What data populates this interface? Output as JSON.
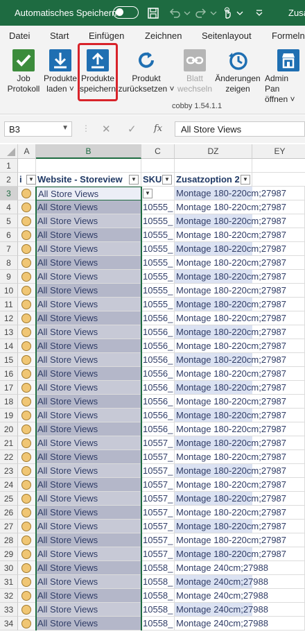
{
  "titlebar": {
    "autosave_label": "Automatisches Speichern",
    "title": "Zusa"
  },
  "tabs": [
    "Datei",
    "Start",
    "Einfügen",
    "Zeichnen",
    "Seitenlayout",
    "Formeln"
  ],
  "ribbon": {
    "buttons": [
      {
        "label1": "Job",
        "label2": "Protokoll",
        "icon": "check-icon",
        "color": "#3c8c3c"
      },
      {
        "label1": "Produkte",
        "label2": "laden ˅",
        "icon": "download-icon",
        "color": "#1f6fb2"
      },
      {
        "label1": "Produkte",
        "label2": "speichern",
        "icon": "upload-icon",
        "color": "#1f6fb2"
      },
      {
        "label1": "Produkt",
        "label2": "zurücksetzen ˅",
        "icon": "reset-icon",
        "color": "#1f6fb2"
      },
      {
        "label1": "Blatt",
        "label2": "wechseln",
        "icon": "chain-icon",
        "color": "#b5b5b5"
      },
      {
        "label1": "Änderungen",
        "label2": "zeigen",
        "icon": "history-icon",
        "color": "#1f6fb2"
      },
      {
        "label1": "Admin Pan",
        "label2": "öffnen ˅",
        "icon": "store-icon",
        "color": "#1f6fb2"
      }
    ],
    "group_label": "cobby 1.54.1.1"
  },
  "formula_bar": {
    "name_box": "B3",
    "fx": "fx",
    "value": "All Store Views"
  },
  "columns": [
    "A",
    "B",
    "C",
    "DZ",
    "EY"
  ],
  "header_row": {
    "a": "i",
    "b": "Website - Storeview",
    "c": "SKU",
    "dz": "Zusatzoption 2"
  },
  "row_numbers": [
    "1",
    "2",
    "3",
    "4",
    "5",
    "6",
    "7",
    "8",
    "9",
    "10",
    "11",
    "12",
    "13",
    "14",
    "15",
    "16",
    "17",
    "18",
    "19",
    "20",
    "21",
    "22",
    "23",
    "24",
    "25",
    "26",
    "27",
    "28",
    "29",
    "30",
    "31",
    "32",
    "33",
    "34"
  ],
  "rows": [
    {
      "b": "All Store Views",
      "c": "",
      "dz": "Montage 180-220cm;27987"
    },
    {
      "b": "All Store Views",
      "c": "10555_",
      "dz": "Montage 180-220cm;27987"
    },
    {
      "b": "All Store Views",
      "c": "10555_",
      "dz": "Montage 180-220cm;27987"
    },
    {
      "b": "All Store Views",
      "c": "10555_",
      "dz": "Montage 180-220cm;27987"
    },
    {
      "b": "All Store Views",
      "c": "10555_",
      "dz": "Montage 180-220cm;27987"
    },
    {
      "b": "All Store Views",
      "c": "10555_",
      "dz": "Montage 180-220cm;27987"
    },
    {
      "b": "All Store Views",
      "c": "10555_",
      "dz": "Montage 180-220cm;27987"
    },
    {
      "b": "All Store Views",
      "c": "10555_",
      "dz": "Montage 180-220cm;27987"
    },
    {
      "b": "All Store Views",
      "c": "10555_",
      "dz": "Montage 180-220cm;27987"
    },
    {
      "b": "All Store Views",
      "c": "10556_",
      "dz": "Montage 180-220cm;27987"
    },
    {
      "b": "All Store Views",
      "c": "10556_",
      "dz": "Montage 180-220cm;27987"
    },
    {
      "b": "All Store Views",
      "c": "10556_",
      "dz": "Montage 180-220cm;27987"
    },
    {
      "b": "All Store Views",
      "c": "10556_",
      "dz": "Montage 180-220cm;27987"
    },
    {
      "b": "All Store Views",
      "c": "10556_",
      "dz": "Montage 180-220cm;27987"
    },
    {
      "b": "All Store Views",
      "c": "10556_",
      "dz": "Montage 180-220cm;27987"
    },
    {
      "b": "All Store Views",
      "c": "10556_",
      "dz": "Montage 180-220cm;27987"
    },
    {
      "b": "All Store Views",
      "c": "10556_",
      "dz": "Montage 180-220cm;27987"
    },
    {
      "b": "All Store Views",
      "c": "10556_",
      "dz": "Montage 180-220cm;27987"
    },
    {
      "b": "All Store Views",
      "c": "10557_",
      "dz": "Montage 180-220cm;27987"
    },
    {
      "b": "All Store Views",
      "c": "10557_",
      "dz": "Montage 180-220cm;27987"
    },
    {
      "b": "All Store Views",
      "c": "10557_",
      "dz": "Montage 180-220cm;27987"
    },
    {
      "b": "All Store Views",
      "c": "10557_",
      "dz": "Montage 180-220cm;27987"
    },
    {
      "b": "All Store Views",
      "c": "10557_",
      "dz": "Montage 180-220cm;27987"
    },
    {
      "b": "All Store Views",
      "c": "10557_",
      "dz": "Montage 180-220cm;27987"
    },
    {
      "b": "All Store Views",
      "c": "10557_",
      "dz": "Montage 180-220cm;27987"
    },
    {
      "b": "All Store Views",
      "c": "10557_",
      "dz": "Montage 180-220cm;27987"
    },
    {
      "b": "All Store Views",
      "c": "10557_",
      "dz": "Montage 180-220cm;27987"
    },
    {
      "b": "All Store Views",
      "c": "10558_",
      "dz": "Montage 240cm;27988"
    },
    {
      "b": "All Store Views",
      "c": "10558_",
      "dz": "Montage 240cm;27988"
    },
    {
      "b": "All Store Views",
      "c": "10558_",
      "dz": "Montage 240cm;27988"
    },
    {
      "b": "All Store Views",
      "c": "10558_",
      "dz": "Montage 240cm;27988"
    },
    {
      "b": "All Store Views",
      "c": "10558_",
      "dz": "Montage 240cm;27988"
    }
  ],
  "colors": {
    "brand_green": "#1e6b41",
    "highlight_red": "#d8232a",
    "status_yellow": "#f0c674"
  }
}
